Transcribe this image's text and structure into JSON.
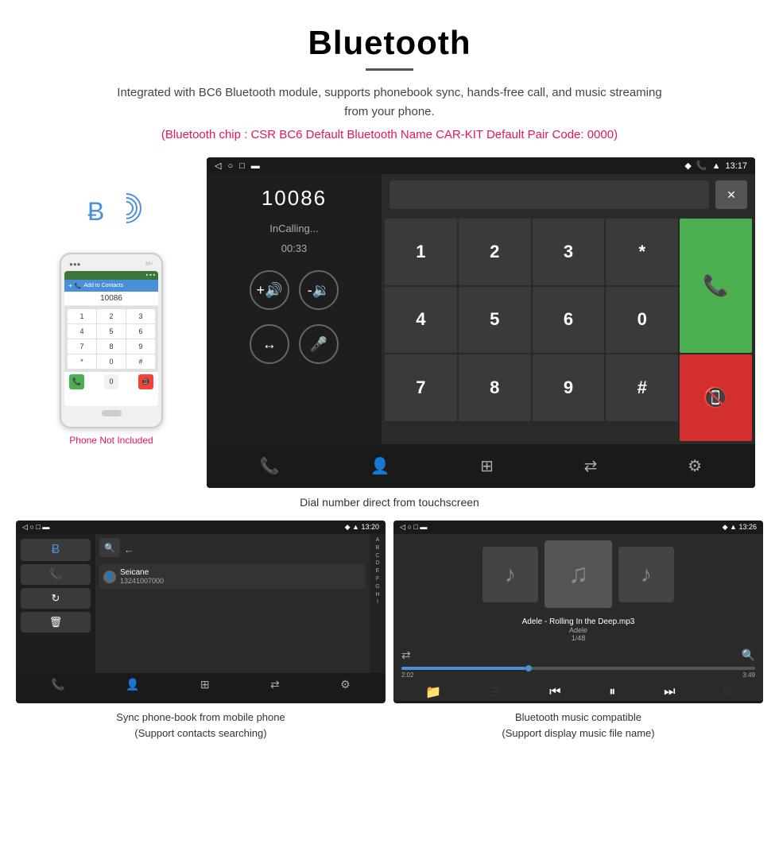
{
  "header": {
    "title": "Bluetooth",
    "description": "Integrated with BC6 Bluetooth module, supports phonebook sync, hands-free call, and music streaming from your phone.",
    "chip_info": "(Bluetooth chip : CSR BC6    Default Bluetooth Name CAR-KIT    Default Pair Code: 0000)"
  },
  "phone_side": {
    "not_included": "Phone Not Included"
  },
  "android_main": {
    "status_time": "13:17",
    "dialer_number": "10086",
    "in_calling": "InCalling...",
    "call_timer": "00:33",
    "keys": [
      "1",
      "2",
      "3",
      "*",
      "4",
      "5",
      "6",
      "0",
      "7",
      "8",
      "9",
      "#"
    ]
  },
  "screen_caption": "Dial number direct from touchscreen",
  "bottom_left": {
    "status_time": "13:20",
    "contact_name": "Seicane",
    "contact_number": "13241007000",
    "caption_line1": "Sync phone-book from mobile phone",
    "caption_line2": "(Support contacts searching)"
  },
  "bottom_right": {
    "status_time": "13:26",
    "song_title": "Adele - Rolling In the Deep.mp3",
    "artist": "Adele",
    "track_num": "1/48",
    "time_current": "2:02",
    "time_total": "3:49",
    "caption_line1": "Bluetooth music compatible",
    "caption_line2": "(Support display music file name)"
  },
  "icons": {
    "bluetooth": "✦",
    "volume_up": "🔊",
    "volume_down": "🔉",
    "transfer": "↔",
    "microphone": "🎤",
    "phone_call": "📞",
    "phone_end": "📵",
    "search": "🔍",
    "contacts": "👤",
    "grid": "⊞",
    "transfer2": "⇄",
    "settings": "⚙",
    "bt_symbol": "⚡",
    "backspace": "⌫",
    "shuffle": "⇄",
    "prev": "⏮",
    "play": "⏸",
    "next": "⏭",
    "equalizer": "≡",
    "folder": "📁",
    "list": "☰",
    "music_note": "♪"
  }
}
